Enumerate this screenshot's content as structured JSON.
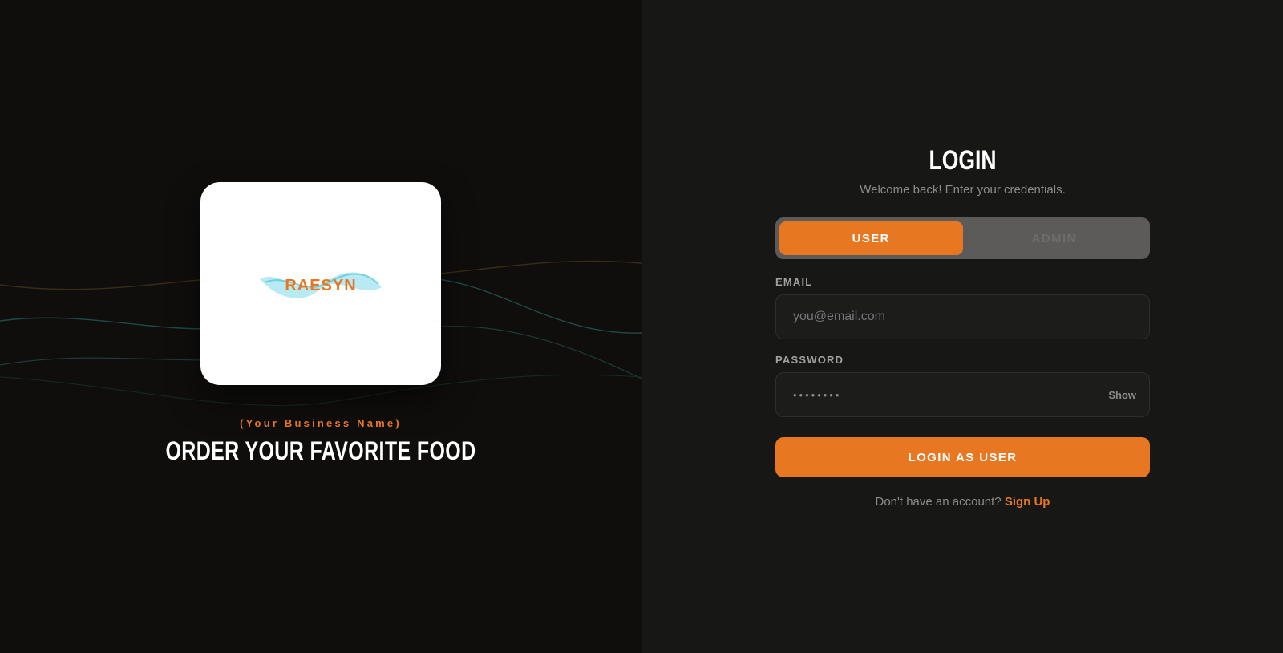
{
  "colors": {
    "accent": "#e87722",
    "left_bg": "#0f0e0c",
    "right_bg": "#171716",
    "toggle_bg": "#5c5b59"
  },
  "brand": {
    "logo_text": "RAESYN",
    "business_name": "(Your Business Name)",
    "tagline": "ORDER YOUR FAVORITE FOOD"
  },
  "login": {
    "title": "LOGIN",
    "subtitle": "Welcome back! Enter your credentials.",
    "roles": [
      {
        "label": "USER",
        "active": true
      },
      {
        "label": "ADMIN",
        "active": false
      }
    ],
    "email": {
      "label": "EMAIL",
      "placeholder": "you@email.com",
      "value": ""
    },
    "password": {
      "label": "PASSWORD",
      "masked_value": "••••••••",
      "show_label": "Show"
    },
    "submit_label": "LOGIN AS USER",
    "signup_prompt": "Don't have an account?",
    "signup_link": "Sign Up"
  }
}
